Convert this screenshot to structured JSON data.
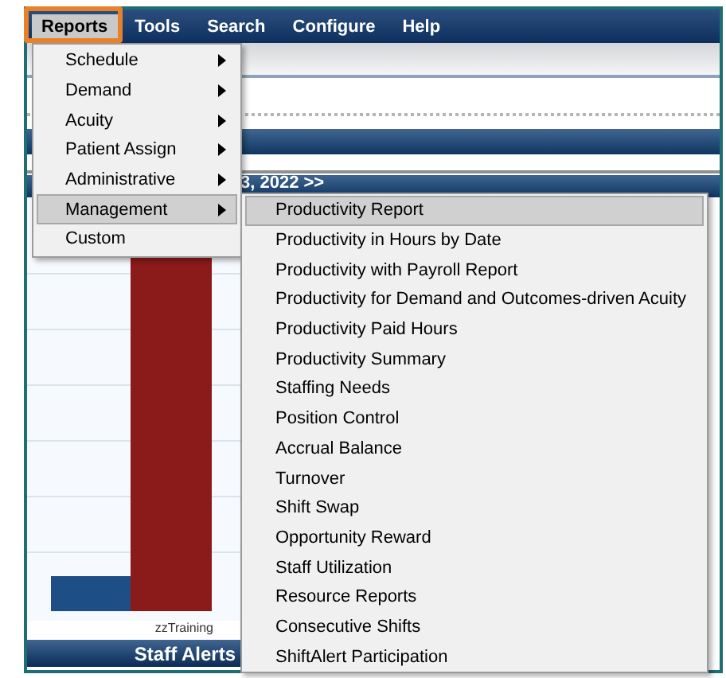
{
  "menubar": [
    {
      "label": "Reports",
      "selected": true
    },
    {
      "label": "Tools",
      "selected": false
    },
    {
      "label": "Search",
      "selected": false
    },
    {
      "label": "Configure",
      "selected": false
    },
    {
      "label": "Help",
      "selected": false
    }
  ],
  "date_nav": {
    "label": "3, 2022 >>"
  },
  "chart": {
    "category": "zzTraining"
  },
  "staff_alerts": {
    "title": "Staff Alerts"
  },
  "reports_menu": [
    {
      "label": "Schedule",
      "submenu": true,
      "selected": false
    },
    {
      "label": "Demand",
      "submenu": true,
      "selected": false
    },
    {
      "label": "Acuity",
      "submenu": true,
      "selected": false
    },
    {
      "label": "Patient Assign",
      "submenu": true,
      "selected": false
    },
    {
      "label": "Administrative",
      "submenu": true,
      "selected": false
    },
    {
      "label": "Management",
      "submenu": true,
      "selected": true
    },
    {
      "label": "Custom",
      "submenu": false,
      "selected": false
    }
  ],
  "management_submenu": [
    {
      "label": "Productivity Report",
      "selected": true
    },
    {
      "label": "Productivity in Hours by Date",
      "selected": false
    },
    {
      "label": "Productivity with Payroll Report",
      "selected": false
    },
    {
      "label": "Productivity for Demand and Outcomes-driven Acuity",
      "selected": false
    },
    {
      "label": "Productivity Paid Hours",
      "selected": false
    },
    {
      "label": "Productivity Summary",
      "selected": false
    },
    {
      "label": "Staffing Needs",
      "selected": false
    },
    {
      "label": "Position Control",
      "selected": false
    },
    {
      "label": "Accrual Balance",
      "selected": false
    },
    {
      "label": "Turnover",
      "selected": false
    },
    {
      "label": "Shift Swap",
      "selected": false
    },
    {
      "label": "Opportunity Reward",
      "selected": false
    },
    {
      "label": "Staff Utilization",
      "selected": false
    },
    {
      "label": "Resource Reports",
      "selected": false
    },
    {
      "label": "Consecutive Shifts",
      "selected": false
    },
    {
      "label": "ShiftAlert Participation",
      "selected": false
    }
  ]
}
